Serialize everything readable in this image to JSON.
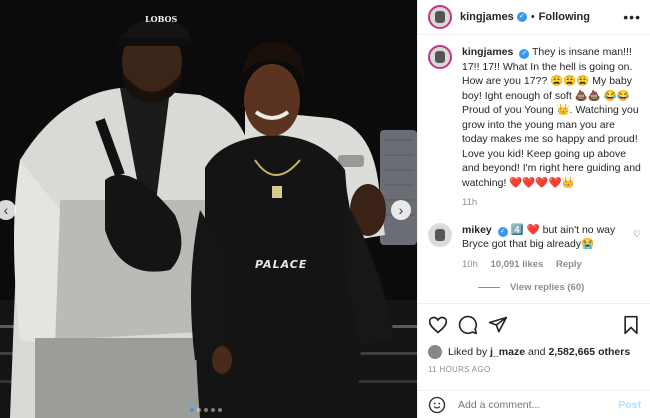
{
  "post": {
    "username": "kingjames",
    "follow_status": "Following",
    "more_label": "•••"
  },
  "caption": {
    "author": "kingjames",
    "text": "They is insane man!!! 17!! 17!! What In the hell is going on. How are you 17?? 😩😩😩 My baby boy! Ight enough of soft 💩💩 😂😂 Proud of you Young 👑. Watching you grow into the young man you are today makes me so happy and proud! Love you kid! Keep going up above and beyond! I'm right here guiding and watching! ❤️❤️❤️❤️👑",
    "time": "11h"
  },
  "comment": {
    "author": "mikey",
    "text": "4️⃣ ❤️ but ain't no way Bryce got that big already😭",
    "time": "10h",
    "likes": "10,091 likes",
    "reply": "Reply",
    "view_replies": "View replies (60)"
  },
  "likes": {
    "prefix": "Liked by",
    "user": "j_maze",
    "and": "and",
    "count": "2,582,665 others"
  },
  "timestamp": "11 HOURS AGO",
  "add_comment": {
    "placeholder": "Add a comment...",
    "post_label": "Post"
  },
  "photo": {
    "hat_text": "LOBOS",
    "shirt_text": "PALACE"
  },
  "icons": {
    "emoji": "smiley-icon",
    "like": "heart-icon",
    "comment": "comment-icon",
    "share": "share-icon",
    "save": "bookmark-icon"
  },
  "carousel": {
    "dots": 5,
    "active_dot": 1
  },
  "colors": {
    "accent": "#3897f0",
    "story_ring": "#c13584"
  }
}
